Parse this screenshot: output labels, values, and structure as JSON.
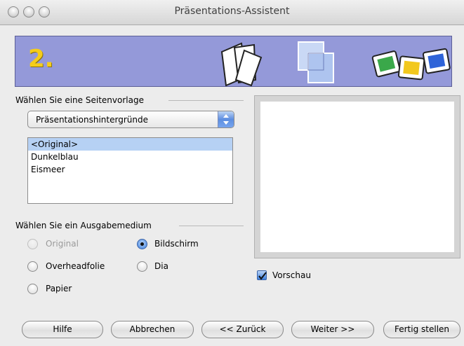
{
  "window": {
    "title": "Präsentations-Assistent"
  },
  "banner": {
    "step": "2."
  },
  "page_template": {
    "group_label": "Wählen Sie eine Seitenvorlage",
    "category_selected": "Präsentationshintergründe",
    "templates": [
      "<Original>",
      "Dunkelblau",
      "Eismeer"
    ],
    "selected_template": "<Original>"
  },
  "output_medium": {
    "group_label": "Wählen Sie ein Ausgabemedium",
    "options": {
      "original": {
        "label": "Original",
        "enabled": false,
        "checked": false
      },
      "bildschirm": {
        "label": "Bildschirm",
        "enabled": true,
        "checked": true
      },
      "overheadfolie": {
        "label": "Overheadfolie",
        "enabled": true,
        "checked": false
      },
      "dia": {
        "label": "Dia",
        "enabled": true,
        "checked": false
      },
      "papier": {
        "label": "Papier",
        "enabled": true,
        "checked": false
      }
    }
  },
  "preview": {
    "checkbox_label": "Vorschau",
    "checked": true
  },
  "buttons": {
    "help": "Hilfe",
    "cancel": "Abbrechen",
    "back": "<< Zurück",
    "next": "Weiter >>",
    "finish": "Fertig stellen"
  },
  "colors": {
    "banner": "#9499d9",
    "step_number": "#f5cd1a",
    "selection": "#b6d1f4",
    "accent": "#3d7fdc"
  },
  "icons": [
    "pages-icon",
    "layers-icon",
    "slides-icon",
    "stepper-arrows-icon",
    "check-icon"
  ]
}
